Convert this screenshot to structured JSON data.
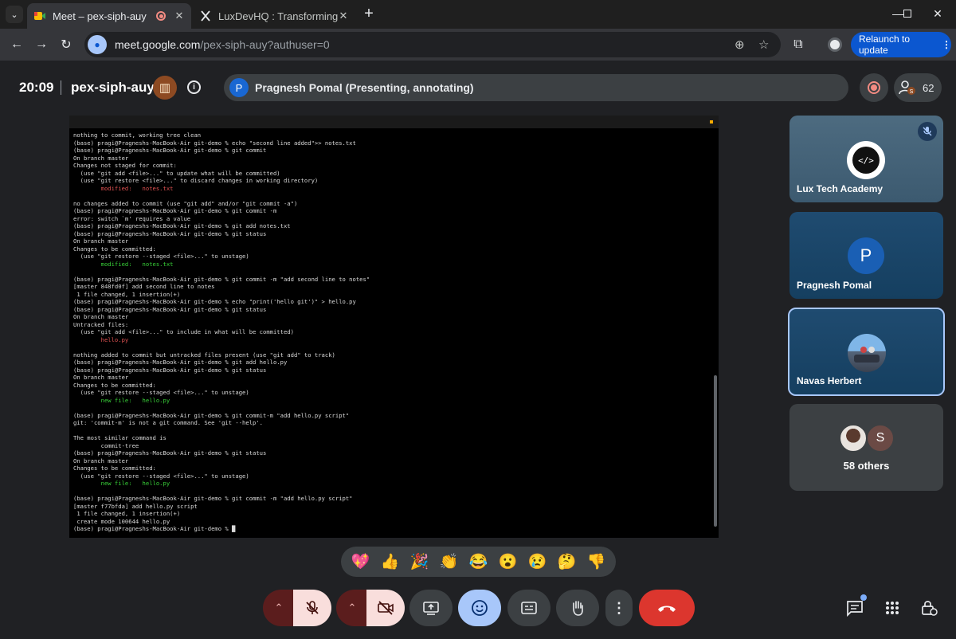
{
  "browser": {
    "tabs": [
      {
        "title": "Meet – pex-siph-auy",
        "active": true
      },
      {
        "title": "LuxDevHQ : Transforming Data",
        "active": false
      }
    ],
    "url_main": "meet.google.com",
    "url_rest": "/pex-siph-auy?authuser=0",
    "relaunch_label": "Relaunch to update"
  },
  "meet": {
    "time": "20:09",
    "meeting_code": "pex-siph-auy",
    "presenter_initial": "P",
    "presenting_text": "Pragnesh Pomal (Presenting, annotating)",
    "participant_count": "62"
  },
  "terminal": {
    "lines": [
      {
        "text": "nothing to commit, working tree clean",
        "c": ""
      },
      {
        "text": "(base) pragi@Pragneshs-MacBook-Air git-demo % echo \"second line added\">> notes.txt",
        "c": ""
      },
      {
        "text": "(base) pragi@Pragneshs-MacBook-Air git-demo % git commit",
        "c": ""
      },
      {
        "text": "On branch master",
        "c": ""
      },
      {
        "text": "Changes not staged for commit:",
        "c": ""
      },
      {
        "text": "  (use \"git add <file>...\" to update what will be committed)",
        "c": ""
      },
      {
        "text": "  (use \"git restore <file>...\" to discard changes in working directory)",
        "c": ""
      },
      {
        "text": "        modified:   notes.txt",
        "c": "red"
      },
      {
        "text": "",
        "c": ""
      },
      {
        "text": "no changes added to commit (use \"git add\" and/or \"git commit -a\")",
        "c": ""
      },
      {
        "text": "(base) pragi@Pragneshs-MacBook-Air git-demo % git commit -m",
        "c": ""
      },
      {
        "text": "error: switch `m' requires a value",
        "c": ""
      },
      {
        "text": "(base) pragi@Pragneshs-MacBook-Air git-demo % git add notes.txt",
        "c": ""
      },
      {
        "text": "(base) pragi@Pragneshs-MacBook-Air git-demo % git status",
        "c": ""
      },
      {
        "text": "On branch master",
        "c": ""
      },
      {
        "text": "Changes to be committed:",
        "c": ""
      },
      {
        "text": "  (use \"git restore --staged <file>...\" to unstage)",
        "c": ""
      },
      {
        "text": "        modified:   notes.txt",
        "c": "green"
      },
      {
        "text": "",
        "c": ""
      },
      {
        "text": "(base) pragi@Pragneshs-MacBook-Air git-demo % git commit -m \"add second line to notes\"",
        "c": ""
      },
      {
        "text": "[master 848fd0f] add second line to notes",
        "c": ""
      },
      {
        "text": " 1 file changed, 1 insertion(+)",
        "c": ""
      },
      {
        "text": "(base) pragi@Pragneshs-MacBook-Air git-demo % echo \"print('hello git')\" > hello.py",
        "c": ""
      },
      {
        "text": "(base) pragi@Pragneshs-MacBook-Air git-demo % git status",
        "c": ""
      },
      {
        "text": "On branch master",
        "c": ""
      },
      {
        "text": "Untracked files:",
        "c": ""
      },
      {
        "text": "  (use \"git add <file>...\" to include in what will be committed)",
        "c": ""
      },
      {
        "text": "        hello.py",
        "c": "red"
      },
      {
        "text": "",
        "c": ""
      },
      {
        "text": "nothing added to commit but untracked files present (use \"git add\" to track)",
        "c": ""
      },
      {
        "text": "(base) pragi@Pragneshs-MacBook-Air git-demo % git add hello.py",
        "c": ""
      },
      {
        "text": "(base) pragi@Pragneshs-MacBook-Air git-demo % git status",
        "c": ""
      },
      {
        "text": "On branch master",
        "c": ""
      },
      {
        "text": "Changes to be committed:",
        "c": ""
      },
      {
        "text": "  (use \"git restore --staged <file>...\" to unstage)",
        "c": ""
      },
      {
        "text": "        new file:   hello.py",
        "c": "green"
      },
      {
        "text": "",
        "c": ""
      },
      {
        "text": "(base) pragi@Pragneshs-MacBook-Air git-demo % git commit-m \"add hello.py script\"",
        "c": ""
      },
      {
        "text": "git: 'commit-m' is not a git command. See 'git --help'.",
        "c": ""
      },
      {
        "text": "",
        "c": ""
      },
      {
        "text": "The most similar command is",
        "c": ""
      },
      {
        "text": "        commit-tree",
        "c": ""
      },
      {
        "text": "(base) pragi@Pragneshs-MacBook-Air git-demo % git status",
        "c": ""
      },
      {
        "text": "On branch master",
        "c": ""
      },
      {
        "text": "Changes to be committed:",
        "c": ""
      },
      {
        "text": "  (use \"git restore --staged <file>...\" to unstage)",
        "c": ""
      },
      {
        "text": "        new file:   hello.py",
        "c": "green"
      },
      {
        "text": "",
        "c": ""
      },
      {
        "text": "(base) pragi@Pragneshs-MacBook-Air git-demo % git commit -m \"add hello.py script\"",
        "c": ""
      },
      {
        "text": "[master f77bfda] add hello.py script",
        "c": ""
      },
      {
        "text": " 1 file changed, 1 insertion(+)",
        "c": ""
      },
      {
        "text": " create mode 100644 hello.py",
        "c": ""
      },
      {
        "text": "(base) pragi@Pragneshs-MacBook-Air git-demo % █",
        "c": ""
      }
    ]
  },
  "participants": [
    {
      "name": "Lux Tech Academy",
      "muted": true,
      "avatar": "logo"
    },
    {
      "name": "Pragnesh Pomal",
      "initial": "P",
      "avatar": "initial"
    },
    {
      "name": "Navas Herbert",
      "avatar": "photo",
      "speaking": true
    }
  ],
  "others": {
    "label": "58 others",
    "initial": "S"
  },
  "reactions": [
    "💖",
    "👍",
    "🎉",
    "👏",
    "😂",
    "😮",
    "😢",
    "🤔",
    "👎"
  ],
  "colors": {
    "meet_bg": "#202124",
    "hangup_red": "#dc362e",
    "mic_off_bg": "#f9dedc",
    "emoji_active_blue": "#a8c7fa",
    "relaunch_blue": "#0b57d0"
  }
}
